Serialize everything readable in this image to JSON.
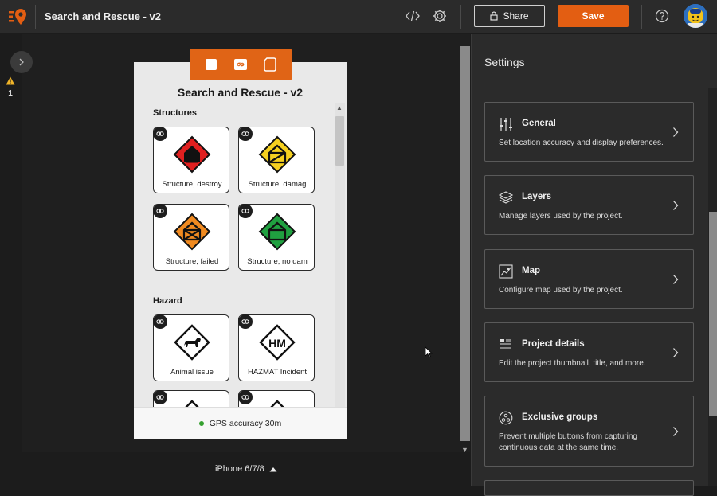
{
  "topbar": {
    "title": "Search and Rescue - v2",
    "share_label": "Share",
    "save_label": "Save",
    "icons": [
      "logo-icon",
      "code-icon",
      "gear-icon",
      "lock-icon",
      "help-icon",
      "avatar"
    ]
  },
  "left_rail": {
    "warning_count": "1"
  },
  "preview": {
    "app_title": "Search and Rescue - v2",
    "sections": [
      {
        "label": "Structures",
        "tiles": [
          {
            "label": "Structure, destroy",
            "color": "#e02020"
          },
          {
            "label": "Structure, damag",
            "color": "#f5d020"
          },
          {
            "label": "Structure, failed",
            "color": "#f08a20"
          },
          {
            "label": "Structure, no dam",
            "color": "#20a040"
          }
        ]
      },
      {
        "label": "Hazard",
        "tiles": [
          {
            "label": "Animal issue",
            "color": "#ffffff"
          },
          {
            "label": "HAZMAT Incident",
            "color": "#ffffff",
            "symbol_text": "HM"
          }
        ]
      }
    ],
    "gps_text": "GPS accuracy 30m",
    "device_label": "iPhone 6/7/8"
  },
  "settings": {
    "title": "Settings",
    "cards": [
      {
        "title": "General",
        "desc": "Set location accuracy and display preferences.",
        "icon": "sliders-icon"
      },
      {
        "title": "Layers",
        "desc": "Manage layers used by the project.",
        "icon": "layers-icon"
      },
      {
        "title": "Map",
        "desc": "Configure map used by the project.",
        "icon": "map-icon"
      },
      {
        "title": "Project details",
        "desc": "Edit the project thumbnail, title, and more.",
        "icon": "details-icon"
      },
      {
        "title": "Exclusive groups",
        "desc": "Prevent multiple buttons from capturing continuous data at the same time.",
        "icon": "groups-icon"
      }
    ]
  },
  "colors": {
    "accent": "#e35e12",
    "gps_ok": "#35a02f"
  }
}
